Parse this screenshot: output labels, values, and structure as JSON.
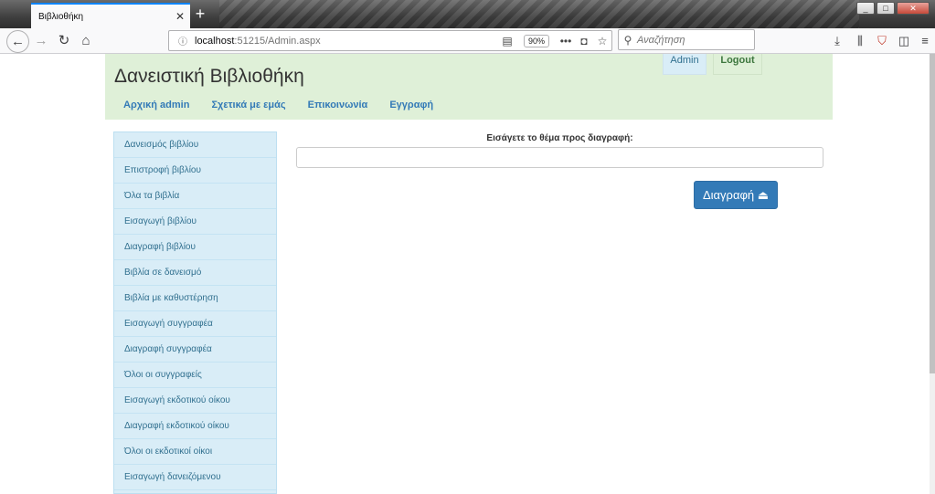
{
  "browser": {
    "tab_title": "Βιβλιοθήκη",
    "tab_close": "✕",
    "new_tab": "+",
    "window_buttons": {
      "minimize": "_",
      "maximize": "□",
      "close": "✕"
    },
    "url_host": "localhost",
    "url_rest": ":51215/Admin.aspx",
    "zoom": "90%",
    "search_placeholder": "Αναζήτηση"
  },
  "icons": {
    "back": "back-arrow-icon",
    "forward": "forward-arrow-icon",
    "reload": "reload-icon",
    "home": "home-icon",
    "info": "info-icon",
    "reader": "reader-view-icon",
    "more": "more-icon",
    "pocket": "pocket-icon",
    "bookmark": "star-icon",
    "search": "search-icon",
    "download": "download-icon",
    "library": "library-icon",
    "ublock": "ublock-icon",
    "sidebar": "sidebar-icon",
    "menu": "menu-icon"
  },
  "colors": {
    "header_bg": "#dff0d8",
    "sidebar_bg": "#d9edf7",
    "link": "#337ab7",
    "primary_button": "#337ab7",
    "tab_accent": "#0a84ff"
  },
  "header": {
    "title": "Δανειστική Βιβλιοθήκη",
    "admin_label": "Admin",
    "logout_label": "Logout",
    "nav": [
      "Αρχική admin",
      "Σχετικά με εμάς",
      "Επικοινωνία",
      "Εγγραφή"
    ]
  },
  "sidebar": {
    "items": [
      "Δανεισμός βιβλίου",
      "Επιστροφή βιβλίου",
      "Όλα τα βιβλία",
      "Εισαγωγή βιβλίου",
      "Διαγραφή βιβλίου",
      "Βιβλία σε δανεισμό",
      "Βιβλία με καθυστέρηση",
      "Εισαγωγή συγγραφέα",
      "Διαγραφή συγγραφέα",
      "Όλοι οι συγγραφείς",
      "Εισαγωγή εκδοτικού οίκου",
      "Διαγραφή εκδοτικού οίκου",
      "Όλοι οι εκδοτικοί οίκοι",
      "Εισαγωγή δανειζόμενου",
      ""
    ]
  },
  "main": {
    "label": "Εισάγετε το θέμα προς διαγραφή:",
    "input_value": "",
    "delete_label": "Διαγραφή ⏏"
  }
}
